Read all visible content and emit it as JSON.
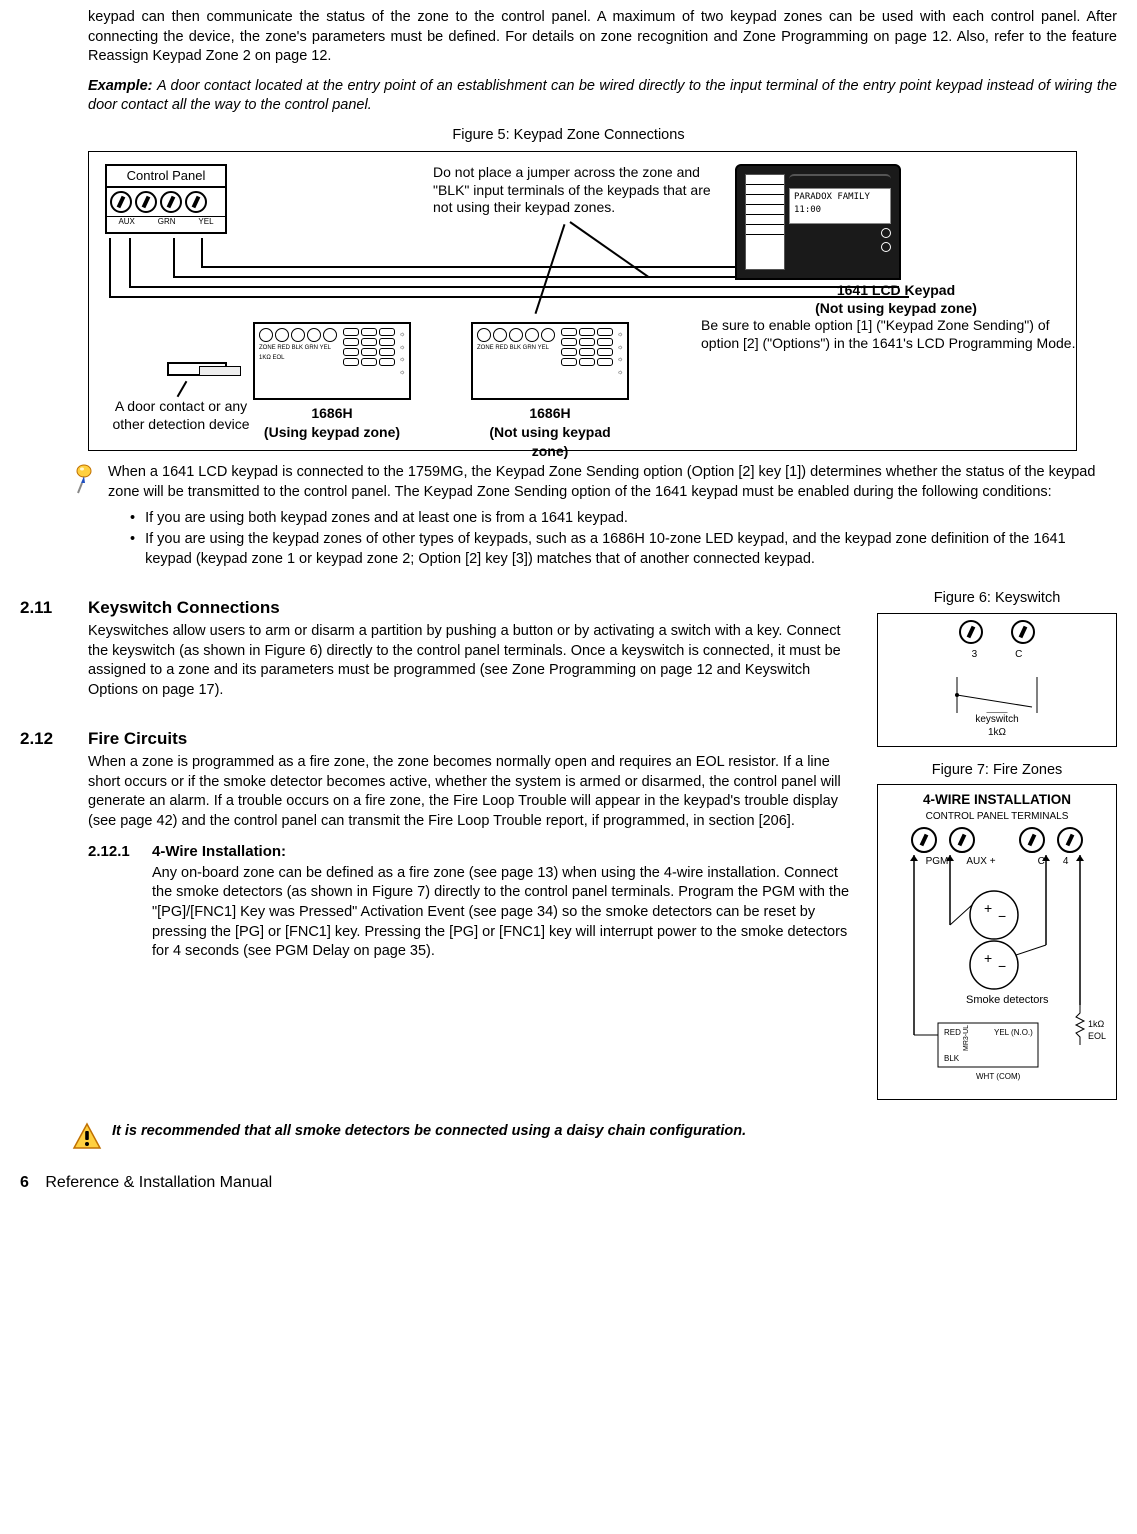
{
  "intro": {
    "p1": "keypad can then communicate the status of the zone to the control panel. A maximum of two keypad zones can be used with each control panel. After connecting the device, the zone's parameters must be defined. For details on zone recognition and Zone Programming on page 12. Also, refer to the feature Reassign Keypad Zone 2 on page 12.",
    "example_label": "Example:",
    "example_text": "A door contact located at the entry point of an establishment can be wired directly to the input terminal of the entry point keypad instead of wiring the door contact all the way to the control panel."
  },
  "fig5": {
    "caption": "Figure 5: Keypad Zone Connections",
    "control_panel": "Control Panel",
    "cp_aux": "AUX",
    "cp_grn": "GRN",
    "cp_yel": "YEL",
    "jumper_note": "Do not place a jumper across the zone and \"BLK\" input terminals of the keypads that are not using their keypad zones.",
    "door_label": "A door contact or any other detection device",
    "kp1_name": "1686H",
    "kp1_sub": "(Using keypad zone)",
    "kp2_name": "1686H",
    "kp2_sub": "(Not using keypad zone)",
    "lcd_name": "1641 LCD Keypad",
    "lcd_sub": "(Not using keypad zone)",
    "lcd_note": "Be sure to enable option [1] (\"Keypad Zone Sending\") of option [2] (\"Options\") in the 1641's LCD Programming Mode.",
    "lcd_screen_l1": "PARADOX FAMILY",
    "lcd_screen_l2": "11:00",
    "term_labels": "ZONE RED BLK GRN YEL",
    "eol_label": "1KΩ EOL"
  },
  "note1": {
    "main": "When a 1641 LCD keypad is connected to the 1759MG, the Keypad Zone Sending option (Option [2] key [1]) determines whether the status of the keypad zone will be transmitted to the control panel. The Keypad Zone Sending option of the 1641 keypad must be enabled during the following conditions:",
    "b1": "If you are using both keypad zones and at least one is from a 1641 keypad.",
    "b2": "If you are using the keypad zones of other types of keypads, such as a 1686H 10-zone LED keypad, and the keypad zone definition of the 1641 keypad (keypad zone 1 or keypad zone 2; Option [2] key [3]) matches that of another connected keypad."
  },
  "sec211": {
    "num": "2.11",
    "title": "Keyswitch Connections",
    "body": "Keyswitches allow users to arm or disarm a partition by pushing a button or by activating a switch with a key. Connect the keyswitch (as shown in Figure 6) directly to the control panel terminals. Once a keyswitch is connected, it must be assigned to a zone and its parameters must be programmed (see Zone Programming on page 12 and Keyswitch Options on page 17)."
  },
  "sec212": {
    "num": "2.12",
    "title": "Fire Circuits",
    "body": "When a zone is programmed as a fire zone, the zone becomes normally open and requires an EOL resistor. If a line short occurs or if the smoke detector becomes active, whether the system is armed or disarmed, the control panel will generate an alarm. If a trouble occurs on a fire zone, the Fire Loop Trouble will appear in the keypad's trouble display (see page 42) and the control panel can transmit the Fire Loop Trouble report, if programmed, in section [206]."
  },
  "sec2121": {
    "num": "2.12.1",
    "title": "4-Wire Installation:",
    "body": "Any on-board zone can be defined as a fire zone (see page 13) when using the 4-wire installation. Connect the smoke detectors (as shown in Figure 7) directly to the control panel terminals. Program the PGM with the \"[PG]/[FNC1] Key was Pressed\" Activation Event (see page 34) so the smoke detectors can be reset by pressing the [PG] or [FNC1] key. Pressing the [PG] or [FNC1] key will interrupt power to the smoke detectors for 4 seconds (see PGM Delay on page 35)."
  },
  "fig6": {
    "caption": "Figure 6: Keyswitch",
    "t1": "3",
    "t2": "C",
    "ks": "keyswitch",
    "r": "1kΩ"
  },
  "fig7": {
    "caption": "Figure 7: Fire Zones",
    "title": "4-WIRE INSTALLATION",
    "sub": "CONTROL PANEL TERMINALS",
    "t": [
      "PGM",
      "AUX +",
      "C",
      "4"
    ],
    "smoke": "Smoke detectors",
    "red": "RED",
    "blk": "BLK",
    "yel": "YEL (N.O.)",
    "wht": "WHT (COM)",
    "relay": "MR3-UL",
    "eol": "1kΩ EOL"
  },
  "warn": "It is recommended that all smoke detectors be connected using a daisy chain configuration.",
  "footer": {
    "page": "6",
    "title": "Reference & Installation Manual"
  }
}
